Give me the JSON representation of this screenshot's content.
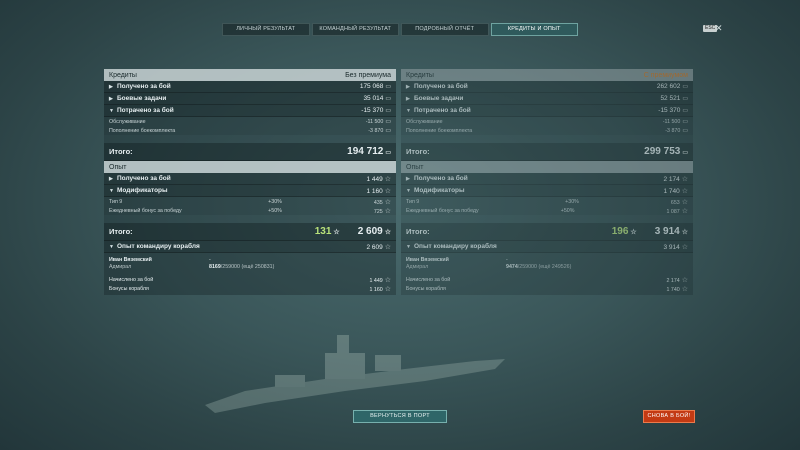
{
  "tabs": [
    {
      "label": "ЛИЧНЫЙ РЕЗУЛЬТАТ"
    },
    {
      "label": "КОМАНДНЫЙ РЕЗУЛЬТАТ"
    },
    {
      "label": "ПОДРОБНЫЙ ОТЧЁТ"
    },
    {
      "label": "КРЕДИТЫ И ОПЫТ"
    }
  ],
  "active_tab": "КРЕДИТЫ И ОПЫТ",
  "esc_label": "ESC",
  "close_glyph": "✕",
  "currency_glyph": "▭",
  "star_glyph": "☆",
  "arrow_right": "▶",
  "arrow_down": "▼",
  "left": {
    "credits_header": "Кредиты",
    "credits_mode": "Без премиума",
    "earned_label": "Получено за бой",
    "earned_value": "175 068",
    "tasks_label": "Боевые задачи",
    "tasks_value": "35 014",
    "spent_label": "Потрачено за бой",
    "spent_value": "-15 370",
    "service_label": "Обслуживание",
    "service_value": "-11 500",
    "ammo_label": "Пополнение боекомплекта",
    "ammo_value": "-3 870",
    "credits_total_label": "Итого:",
    "credits_total_value": "194 712",
    "xp_header": "Опыт",
    "xp_earned_label": "Получено за бой",
    "xp_earned_value": "1 449",
    "mods_label": "Модификаторы",
    "mods_value": "1 160",
    "tier_label": "Тип 9",
    "tier_pct": "+30%",
    "tier_value": "435",
    "daily_label": "Ежедневный бонус за победу",
    "daily_pct": "+50%",
    "daily_value": "725",
    "xp_total_label": "Итого:",
    "xp_total_free": "131",
    "xp_total_value": "2 609",
    "cmd_label": "Опыт командиру корабля",
    "cmd_value": "2 609",
    "cmd_name": "Иван Вяземский",
    "cmd_rank": "Адмирал",
    "cmd_dash": "-",
    "cmd_xp": "8169",
    "cmd_xp_max": "/259000",
    "cmd_xp_left": "(ещё 250831)",
    "cmd_battle_label": "Начислено за бой",
    "cmd_battle_value": "1 449",
    "cmd_bonus_label": "Бонусы корабля",
    "cmd_bonus_value": "1 160"
  },
  "right": {
    "credits_header": "Кредиты",
    "credits_mode": "С премиумом",
    "earned_label": "Получено за бой",
    "earned_value": "262 602",
    "tasks_label": "Боевые задачи",
    "tasks_value": "52 521",
    "spent_label": "Потрачено за бой",
    "spent_value": "-15 370",
    "service_label": "Обслуживание",
    "service_value": "-11 500",
    "ammo_label": "Пополнение боекомплекта",
    "ammo_value": "-3 870",
    "credits_total_label": "Итого:",
    "credits_total_value": "299 753",
    "xp_header": "Опыт",
    "xp_earned_label": "Получено за бой",
    "xp_earned_value": "2 174",
    "mods_label": "Модификаторы",
    "mods_value": "1 740",
    "tier_label": "Тип 9",
    "tier_pct": "+30%",
    "tier_value": "653",
    "daily_label": "Ежедневный бонус за победу",
    "daily_pct": "+50%",
    "daily_value": "1 087",
    "xp_total_label": "Итого:",
    "xp_total_free": "196",
    "xp_total_value": "3 914",
    "cmd_label": "Опыт командиру корабля",
    "cmd_value": "3 914",
    "cmd_name": "Иван Вяземский",
    "cmd_rank": "Адмирал",
    "cmd_dash": "-",
    "cmd_xp": "9474",
    "cmd_xp_max": "/259000",
    "cmd_xp_left": "(ещё 249526)",
    "cmd_battle_label": "Начислено за бой",
    "cmd_battle_value": "2 174",
    "cmd_bonus_label": "Бонусы корабля",
    "cmd_bonus_value": "1 740"
  },
  "buttons": {
    "port": "ВЕРНУТЬСЯ В ПОРТ",
    "battle": "СНОВА В БОЙ!"
  },
  "colors": {
    "premium": "#e07b1f",
    "free_xp": "#b9e27a",
    "battle_button": "#c33a13",
    "port_button": "#2f6668"
  }
}
